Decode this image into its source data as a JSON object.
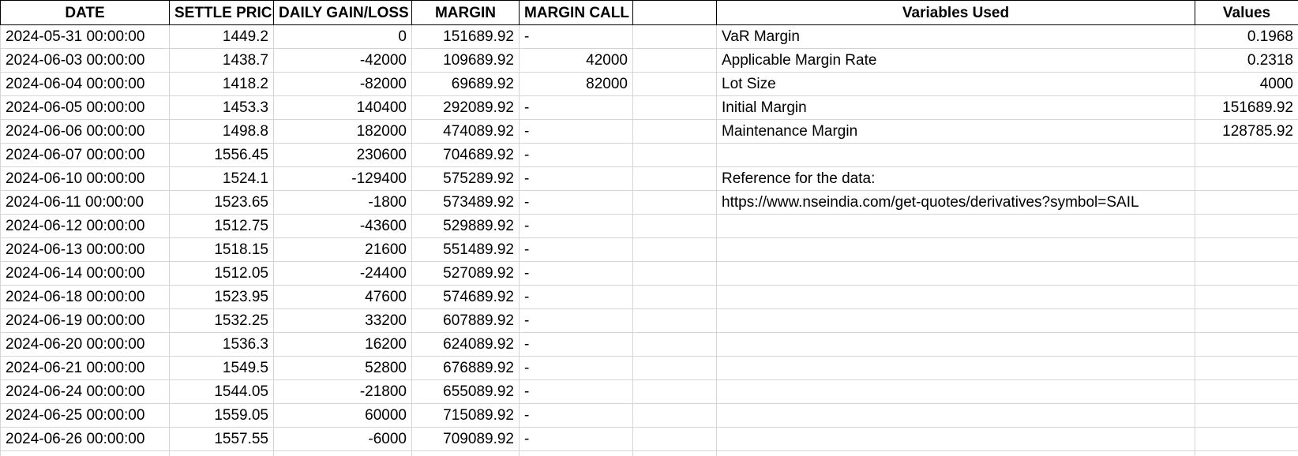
{
  "headers": {
    "date": "DATE",
    "settle_price": "SETTLE PRICE",
    "daily_gain_loss": "DAILY GAIN/LOSS",
    "margin": "MARGIN",
    "margin_call": "MARGIN CALL",
    "variables_used": "Variables Used",
    "values": "Values"
  },
  "rows": [
    {
      "date": "2024-05-31 00:00:00",
      "settle": "1449.2",
      "gain": "0",
      "margin": "151689.92",
      "call": "-",
      "var": "VaR Margin",
      "val": "0.1968"
    },
    {
      "date": "2024-06-03 00:00:00",
      "settle": "1438.7",
      "gain": "-42000",
      "margin": "109689.92",
      "call": "42000",
      "var": "Applicable Margin Rate",
      "val": "0.2318"
    },
    {
      "date": "2024-06-04 00:00:00",
      "settle": "1418.2",
      "gain": "-82000",
      "margin": "69689.92",
      "call": "82000",
      "var": "Lot Size",
      "val": "4000"
    },
    {
      "date": "2024-06-05 00:00:00",
      "settle": "1453.3",
      "gain": "140400",
      "margin": "292089.92",
      "call": "-",
      "var": "Initial Margin",
      "val": "151689.92"
    },
    {
      "date": "2024-06-06 00:00:00",
      "settle": "1498.8",
      "gain": "182000",
      "margin": "474089.92",
      "call": "-",
      "var": "Maintenance Margin",
      "val": "128785.92"
    },
    {
      "date": "2024-06-07 00:00:00",
      "settle": "1556.45",
      "gain": "230600",
      "margin": "704689.92",
      "call": "-",
      "var": "",
      "val": ""
    },
    {
      "date": "2024-06-10 00:00:00",
      "settle": "1524.1",
      "gain": "-129400",
      "margin": "575289.92",
      "call": "-",
      "var": "Reference for the data:",
      "val": ""
    },
    {
      "date": "2024-06-11 00:00:00",
      "settle": "1523.65",
      "gain": "-1800",
      "margin": "573489.92",
      "call": "-",
      "var": "https://www.nseindia.com/get-quotes/derivatives?symbol=SAIL",
      "val": ""
    },
    {
      "date": "2024-06-12 00:00:00",
      "settle": "1512.75",
      "gain": "-43600",
      "margin": "529889.92",
      "call": "-",
      "var": "",
      "val": ""
    },
    {
      "date": "2024-06-13 00:00:00",
      "settle": "1518.15",
      "gain": "21600",
      "margin": "551489.92",
      "call": "-",
      "var": "",
      "val": ""
    },
    {
      "date": "2024-06-14 00:00:00",
      "settle": "1512.05",
      "gain": "-24400",
      "margin": "527089.92",
      "call": "-",
      "var": "",
      "val": ""
    },
    {
      "date": "2024-06-18 00:00:00",
      "settle": "1523.95",
      "gain": "47600",
      "margin": "574689.92",
      "call": "-",
      "var": "",
      "val": ""
    },
    {
      "date": "2024-06-19 00:00:00",
      "settle": "1532.25",
      "gain": "33200",
      "margin": "607889.92",
      "call": "-",
      "var": "",
      "val": ""
    },
    {
      "date": "2024-06-20 00:00:00",
      "settle": "1536.3",
      "gain": "16200",
      "margin": "624089.92",
      "call": "-",
      "var": "",
      "val": ""
    },
    {
      "date": "2024-06-21 00:00:00",
      "settle": "1549.5",
      "gain": "52800",
      "margin": "676889.92",
      "call": "-",
      "var": "",
      "val": ""
    },
    {
      "date": "2024-06-24 00:00:00",
      "settle": "1544.05",
      "gain": "-21800",
      "margin": "655089.92",
      "call": "-",
      "var": "",
      "val": ""
    },
    {
      "date": "2024-06-25 00:00:00",
      "settle": "1559.05",
      "gain": "60000",
      "margin": "715089.92",
      "call": "-",
      "var": "",
      "val": ""
    },
    {
      "date": "2024-06-26 00:00:00",
      "settle": "1557.55",
      "gain": "-6000",
      "margin": "709089.92",
      "call": "-",
      "var": "",
      "val": ""
    }
  ]
}
